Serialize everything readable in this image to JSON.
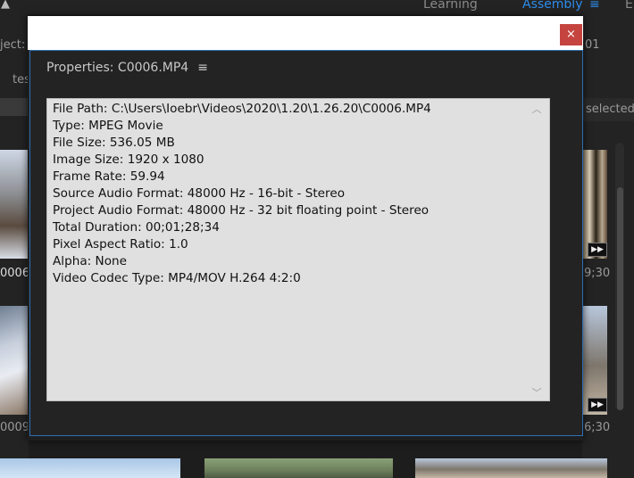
{
  "background": {
    "workspace_tabs": [
      {
        "label": "Learning",
        "active": false
      },
      {
        "label": "Assembly",
        "active": true
      },
      {
        "label": "E",
        "active": false
      }
    ],
    "workspace_menu_icon": "hamburger-icon",
    "left_fragments": {
      "project_label": "ject: #",
      "tab_fragment": "tes",
      "clip1_name": "0006",
      "clip2_name": "0009"
    },
    "right_fragments": {
      "counter": "01",
      "selected_label": "selected",
      "duration1": "9;30",
      "duration2": "6;30"
    },
    "accent_color": "#2d8ceb"
  },
  "dialog": {
    "close_label": "×",
    "close_color": "#c5443f",
    "panel_title": "Properties: C0006.MP4",
    "panel_menu_icon": "hamburger-icon",
    "panel_border_color": "#2d6fb3",
    "properties": [
      "File Path: C:\\Users\\Ioebr\\Videos\\2020\\1.20\\1.26.20\\C0006.MP4",
      "Type: MPEG Movie",
      "File Size: 536.05 MB",
      "Image Size: 1920 x 1080",
      "Frame Rate: 59.94",
      "Source Audio Format: 48000 Hz - 16-bit - Stereo",
      "Project Audio Format: 48000 Hz - 32 bit floating point - Stereo",
      "Total Duration: 00;01;28;34",
      "Pixel Aspect Ratio: 1.0",
      "Alpha: None",
      "Video Codec Type: MP4/MOV H.264 4:2:0"
    ]
  }
}
